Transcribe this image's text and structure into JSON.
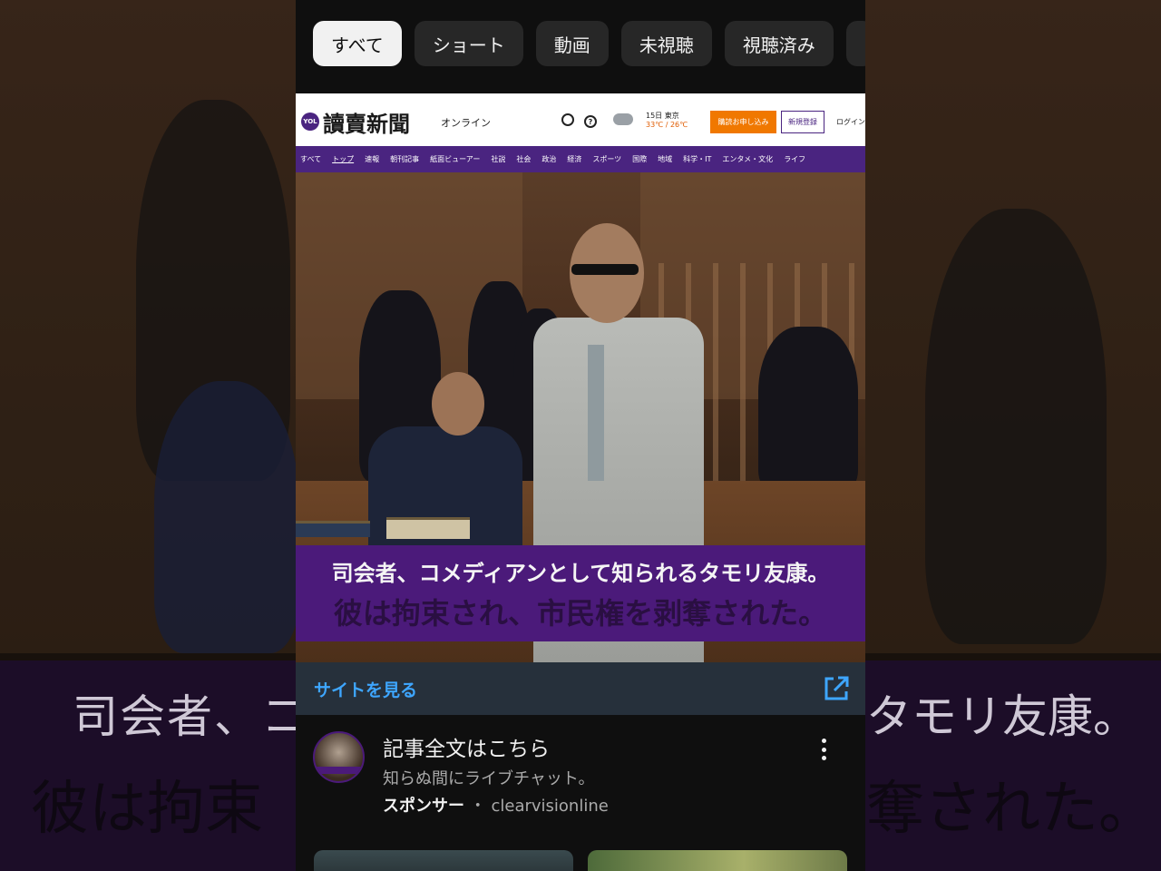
{
  "chips": [
    {
      "label": "すべて",
      "active": true
    },
    {
      "label": "ショート",
      "active": false
    },
    {
      "label": "動画",
      "active": false
    },
    {
      "label": "未視聴",
      "active": false
    },
    {
      "label": "視聴済み",
      "active": false
    }
  ],
  "ad": {
    "site_header": {
      "logo_mark": "YOL",
      "logo_text": "讀賣新聞",
      "logo_sub": "オンライン",
      "weather_date": "15日 東京",
      "weather_temp": "33℃ / 26℃",
      "subscribe_button": "購読お申し込み",
      "register_button": "新規登録",
      "login_link": "ログイン"
    },
    "site_nav": [
      "すべて",
      "トップ",
      "速報",
      "朝刊記事",
      "紙面ビューアー",
      "社説",
      "社会",
      "政治",
      "経済",
      "スポーツ",
      "国際",
      "地域",
      "科学・IT",
      "エンタメ・文化",
      "ライフ"
    ],
    "caption_line1": "司会者、コメディアンとして知られるタモリ友康。",
    "caption_line2": "彼は拘束され、市民権を剥奪された。"
  },
  "visit_site": {
    "label": "サイトを見る"
  },
  "video_meta": {
    "title": "記事全文はこちら",
    "subtitle": "知らぬ間にライブチャット。",
    "sponsor_label": "スポンサー",
    "separator": "・",
    "advertiser": "clearvisionline"
  },
  "backdrop": {
    "line1_left": "司会者、コ",
    "line1_right": "タモリ友康。",
    "line2_left": "彼は拘束",
    "line2_right": "奪された。"
  },
  "colors": {
    "accent_link": "#3ea6ff",
    "caption_band": "#4b1a7a",
    "site_brand": "#4a2480",
    "subscribe_orange": "#f07800"
  }
}
